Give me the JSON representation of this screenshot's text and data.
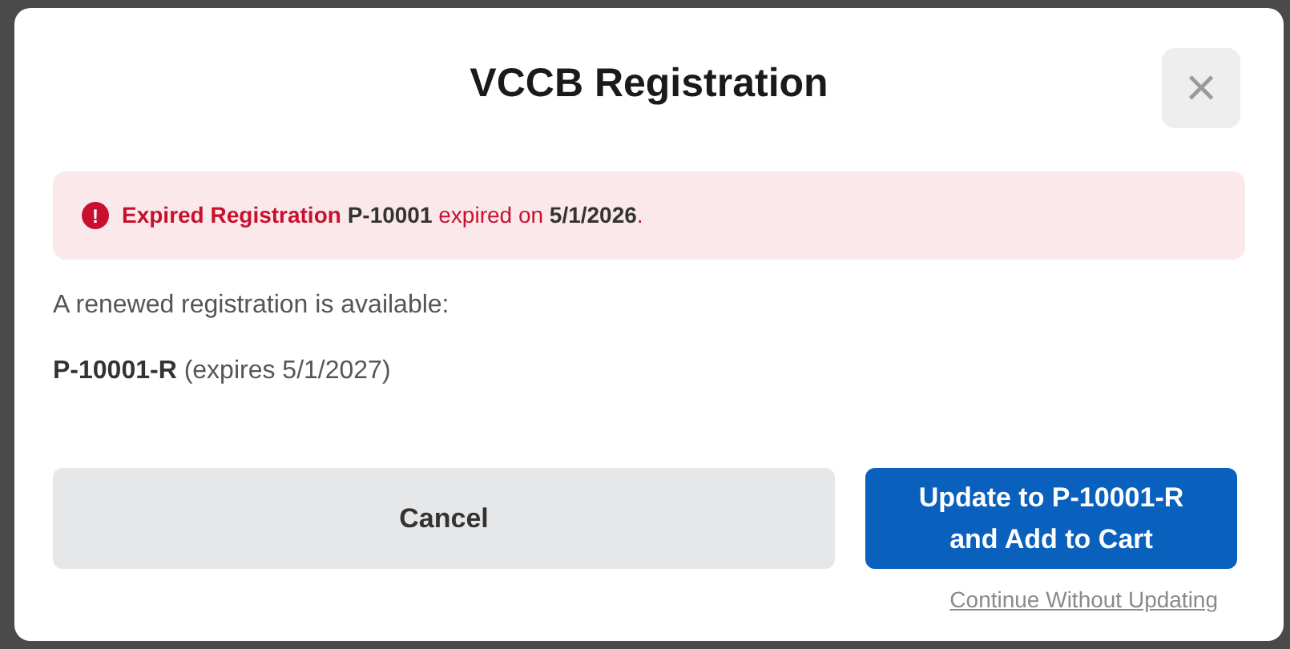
{
  "dialog": {
    "title": "VCCB Registration",
    "close_button": {
      "label": "×"
    },
    "alert": {
      "kind": "error",
      "icon": "!",
      "heading": "Expired Registration",
      "message": "**P-10001** expired on **5/1/2026**."
    },
    "body": [
      "A renewed registration is available:",
      "**P-10001-R** (expires 5/1/2027)"
    ],
    "buttons": [
      {
        "kind": "secondary",
        "label": "Cancel"
      },
      {
        "kind": "primary",
        "label": "Update to P-10001-R and Add to Cart"
      }
    ],
    "link": "Continue Without Updating"
  }
}
